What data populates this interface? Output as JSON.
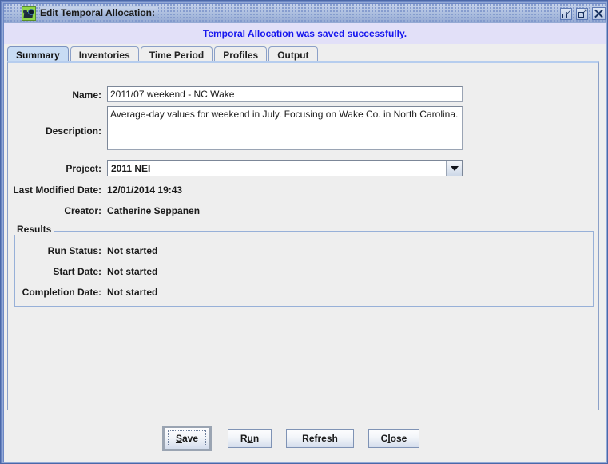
{
  "window": {
    "title": "Edit Temporal Allocation:",
    "icon": "film-camera-icon",
    "controls": {
      "minimize": "minimize-icon",
      "maximize": "maximize-icon",
      "close": "close-icon"
    }
  },
  "message": {
    "text": "Temporal Allocation was saved successfully.",
    "color": "#1515ee",
    "background": "#e2e0f8"
  },
  "tabs": [
    {
      "label": "Summary",
      "active": true
    },
    {
      "label": "Inventories",
      "active": false
    },
    {
      "label": "Time Period",
      "active": false
    },
    {
      "label": "Profiles",
      "active": false
    },
    {
      "label": "Output",
      "active": false
    }
  ],
  "summary": {
    "name": {
      "label": "Name:",
      "value": "2011/07 weekend - NC Wake"
    },
    "description": {
      "label": "Description:",
      "value": "Average-day values for weekend in July. Focusing on Wake Co. in North Carolina."
    },
    "project": {
      "label": "Project:",
      "value": "2011 NEI"
    },
    "last_modified": {
      "label": "Last Modified Date:",
      "value": "12/01/2014 19:43"
    },
    "creator": {
      "label": "Creator:",
      "value": "Catherine Seppanen"
    }
  },
  "results": {
    "title": "Results",
    "run_status": {
      "label": "Run Status:",
      "value": "Not started"
    },
    "start_date": {
      "label": "Start Date:",
      "value": "Not started"
    },
    "completion_date": {
      "label": "Completion Date:",
      "value": "Not started"
    }
  },
  "buttons": {
    "save": {
      "label": "Save",
      "mnemonic": "S",
      "focused": true
    },
    "run": {
      "label": "Run",
      "mnemonic": "u"
    },
    "refresh": {
      "label": "Refresh",
      "mnemonic": ""
    },
    "close": {
      "label": "Close",
      "mnemonic": "l"
    }
  }
}
